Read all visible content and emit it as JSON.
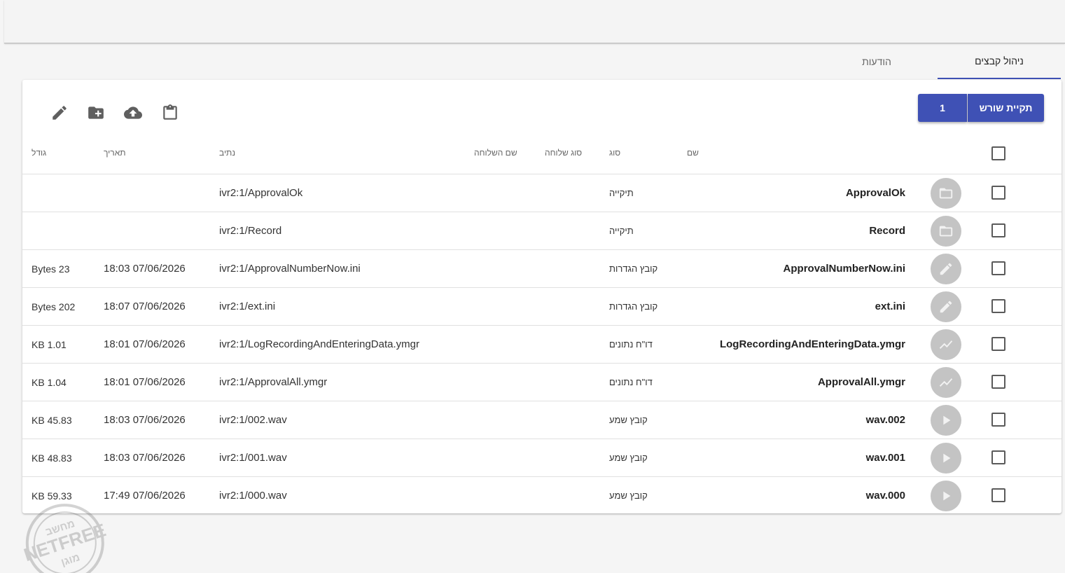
{
  "tabs": [
    {
      "label": "ניהול קבצים",
      "active": true
    },
    {
      "label": "הודעות",
      "active": false
    }
  ],
  "breadcrumb": {
    "root_label": "תקיית שורש",
    "current_label": "1"
  },
  "toolbar": [
    "clipboard-icon",
    "cloud-upload-icon",
    "create-folder-icon",
    "pencil-icon"
  ],
  "columns": {
    "name": "שם",
    "type": "סוג",
    "ext_type": "סוג שלוחה",
    "ext_name": "שם השלוחה",
    "path": "נתיב",
    "date": "תאריך",
    "size": "גודל"
  },
  "rows": [
    {
      "icon": "folder-icon",
      "name": "ApprovalOk",
      "type": "תיקייה",
      "path": "ivr2:1/ApprovalOk",
      "date": "",
      "size": ""
    },
    {
      "icon": "folder-icon",
      "name": "Record",
      "type": "תיקייה",
      "path": "ivr2:1/Record",
      "date": "",
      "size": ""
    },
    {
      "icon": "pencil-icon",
      "name": "ApprovalNumberNow.ini",
      "type": "קובץ הגדרות",
      "path": "ivr2:1/ApprovalNumberNow.ini",
      "date": "18:03 07/06/2026",
      "size": "Bytes 23"
    },
    {
      "icon": "pencil-icon",
      "name": "ext.ini",
      "type": "קובץ הגדרות",
      "path": "ivr2:1/ext.ini",
      "date": "18:07 07/06/2026",
      "size": "Bytes 202"
    },
    {
      "icon": "chart-line-icon",
      "name": "LogRecordingAndEnteringData.ymgr",
      "type": "דו\"ח נתונים",
      "path": "ivr2:1/LogRecordingAndEnteringData.ymgr",
      "date": "18:01 07/06/2026",
      "size": "KB 1.01"
    },
    {
      "icon": "chart-line-icon",
      "name": "ApprovalAll.ymgr",
      "type": "דו\"ח נתונים",
      "path": "ivr2:1/ApprovalAll.ymgr",
      "date": "18:01 07/06/2026",
      "size": "KB 1.04"
    },
    {
      "icon": "play-icon",
      "name": "wav.002",
      "type": "קובץ שמע",
      "path": "ivr2:1/002.wav",
      "date": "18:03 07/06/2026",
      "size": "KB 45.83"
    },
    {
      "icon": "play-icon",
      "name": "wav.001",
      "type": "קובץ שמע",
      "path": "ivr2:1/001.wav",
      "date": "18:03 07/06/2026",
      "size": "KB 48.83"
    },
    {
      "icon": "play-icon",
      "name": "wav.000",
      "type": "קובץ שמע",
      "path": "ivr2:1/000.wav",
      "date": "17:49 07/06/2026",
      "size": "KB 59.33"
    }
  ],
  "watermark": {
    "top_text": "מחשב",
    "middle_text": "NETFREE",
    "bottom_text": "מוגן"
  },
  "colors": {
    "accent": "#3f51b5",
    "icon_circle": "#c4c4c4",
    "background": "#f5f5f5"
  }
}
